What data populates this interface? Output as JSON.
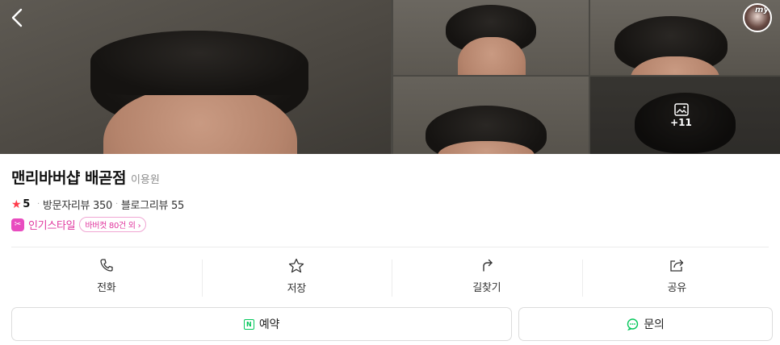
{
  "gallery": {
    "more_photos_count": "+11",
    "my_badge": "my"
  },
  "place": {
    "name": "맨리바버샵 배곧점",
    "category": "이용원",
    "rating": "5",
    "visitor_reviews": "방문자리뷰 350",
    "blog_reviews": "블로그리뷰 55",
    "popular_label": "인기스타일",
    "popular_chip": "바버컷 80건 외 ›"
  },
  "actions": [
    {
      "label": "전화",
      "icon": "phone-icon"
    },
    {
      "label": "저장",
      "icon": "star-outline-icon"
    },
    {
      "label": "길찾기",
      "icon": "directions-icon"
    },
    {
      "label": "공유",
      "icon": "share-icon"
    }
  ],
  "buttons": {
    "reserve": "예약",
    "inquiry": "문의"
  },
  "colors": {
    "accent_pink": "#e0379e",
    "naver_green": "#03c75a",
    "star_red": "#ff3b4a"
  }
}
